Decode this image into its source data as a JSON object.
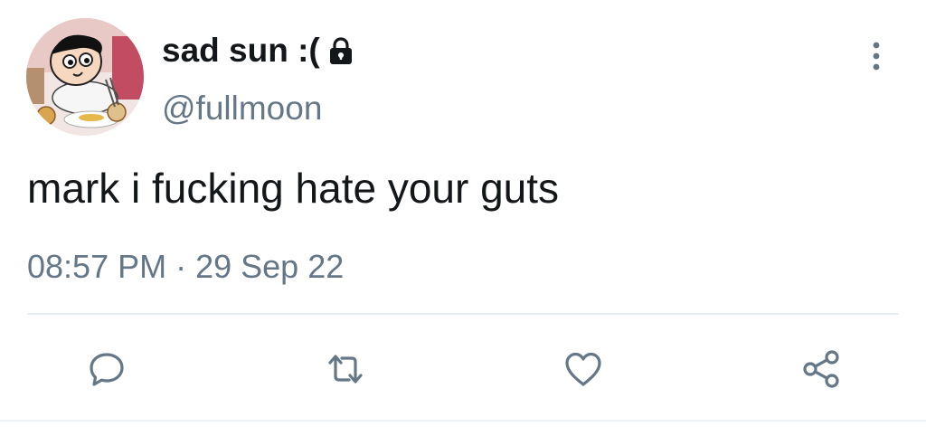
{
  "tweet": {
    "author": {
      "display_name": "sad sun :(",
      "handle": "@fullmoon",
      "avatar_icon": "cartoon-boy-avatar",
      "protected_icon": "lock-icon"
    },
    "text": "mark i fucking hate your guts",
    "time": "08:57 PM",
    "separator": "·",
    "date": "29 Sep 22",
    "menu_icon": "more-vertical-icon"
  },
  "actions": {
    "reply_icon": "reply-icon",
    "retweet_icon": "retweet-icon",
    "like_icon": "heart-icon",
    "share_icon": "share-icon"
  },
  "colors": {
    "text_primary": "#14171a",
    "text_secondary": "#657786",
    "divider": "#e6ecf0"
  }
}
